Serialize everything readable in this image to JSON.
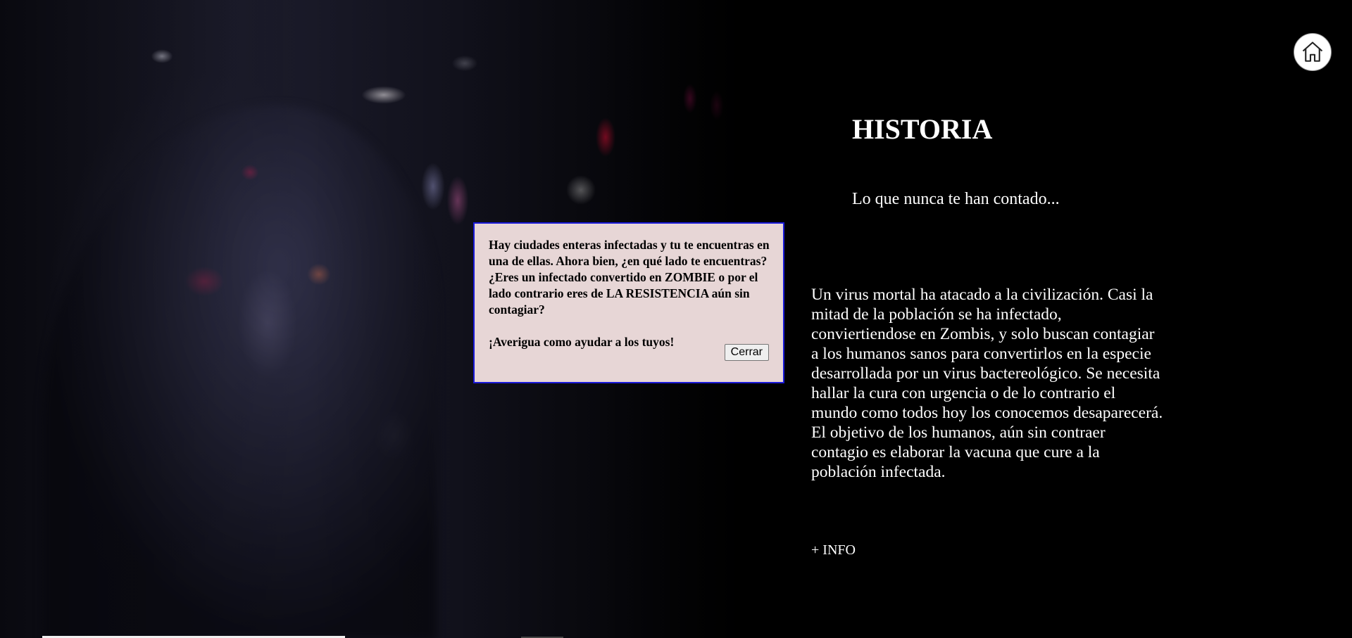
{
  "header": {
    "home_icon": "home-icon"
  },
  "main": {
    "title": "HISTORIA",
    "subtitle": "Lo que nunca te han contado...",
    "story": "Un virus mortal ha atacado a la civilización. Casi la mitad de la población se ha infectado, conviertiendose en Zombis, y solo buscan contagiar a los humanos sanos para convertirlos en la especie desarrollada por un virus bactereológico. Se necesita hallar la cura con urgencia o de lo contrario el mundo como todos hoy los conocemos desaparecerá. El objetivo de los humanos, aún sin contraer contagio es elaborar la vacuna que cure a la población infectada.",
    "more_info_label": "+ INFO"
  },
  "modal": {
    "message": "Hay ciudades enteras infectadas y tu te encuentras en una de ellas. Ahora bien, ¿en qué lado te encuentras? ¿Eres un infectado convertido en ZOMBIE o por el lado contrario eres de LA RESISTENCIA aún sin contagiar?",
    "call_to_action": "¡Averigua como ayudar a los tuyos!",
    "close_label": "Cerrar"
  },
  "colors": {
    "background": "#000000",
    "modal_background": "#e7d6d6",
    "modal_border": "#1a1ad9",
    "text": "#ffffff"
  }
}
